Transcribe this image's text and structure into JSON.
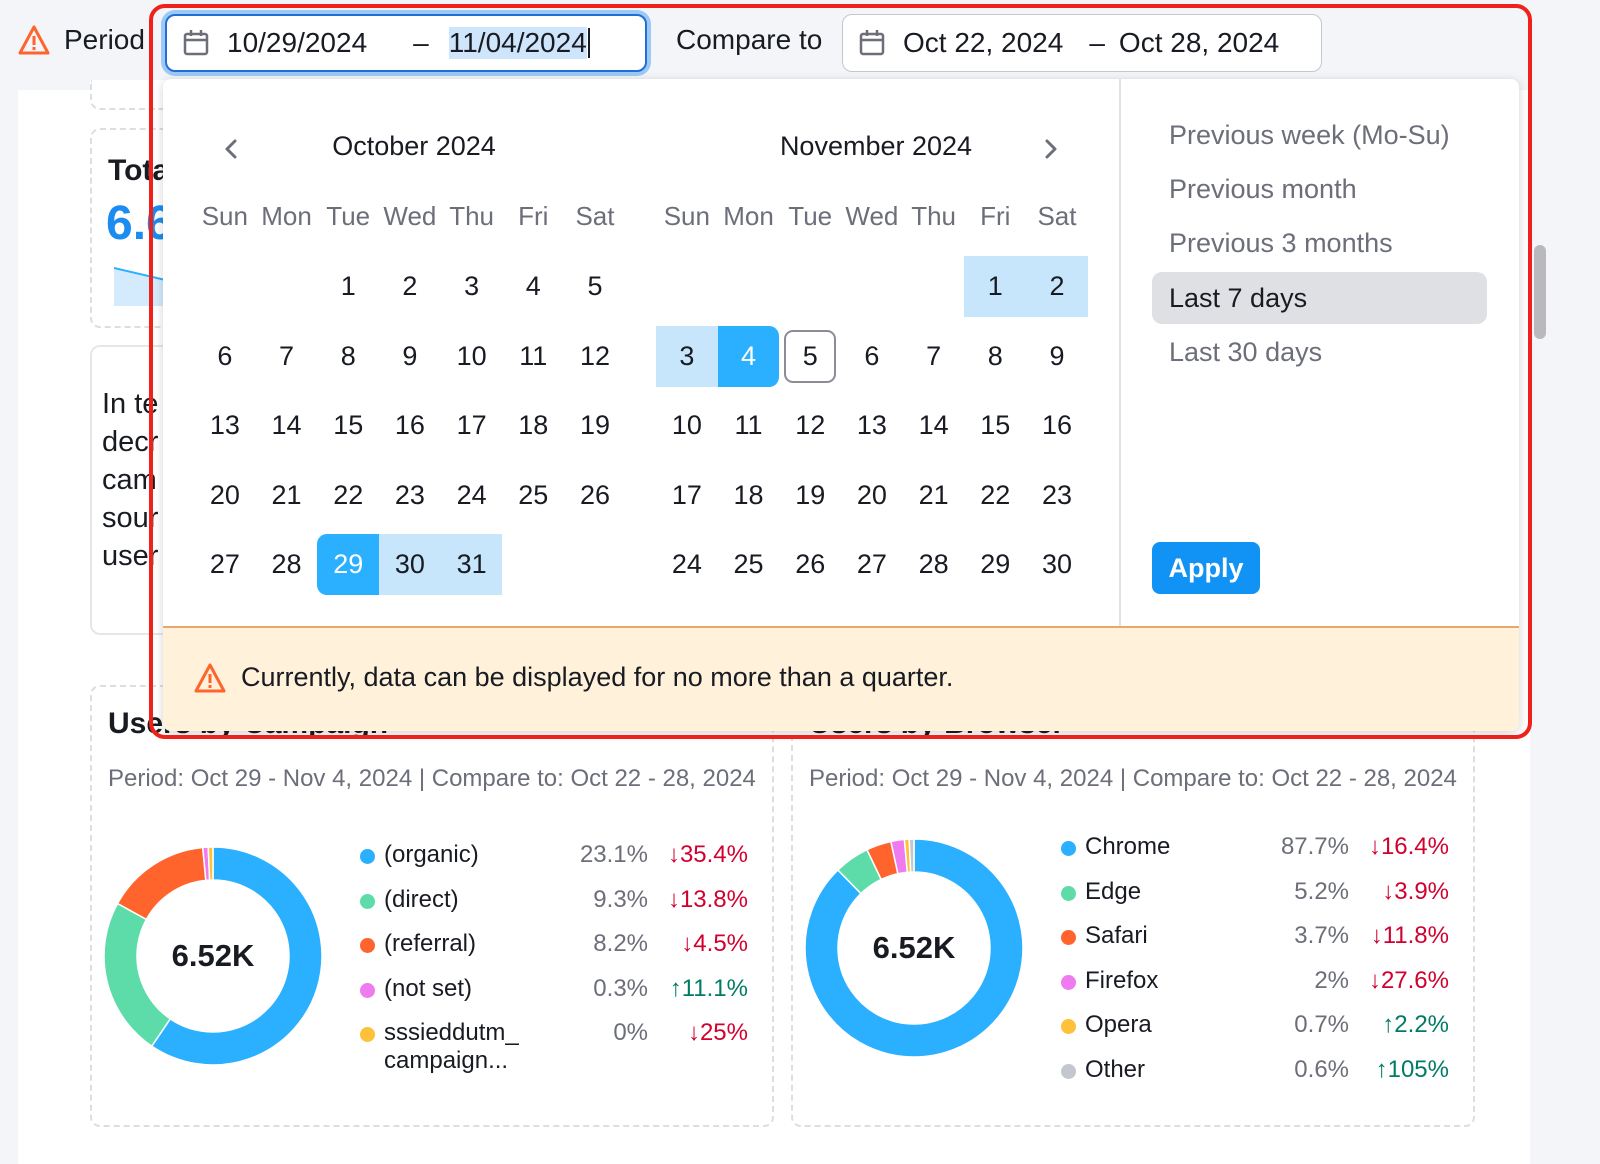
{
  "header": {
    "period_label": "Period",
    "period_start": "10/29/2024",
    "period_separator": "–",
    "period_end": "11/04/2024",
    "compare_label": "Compare to",
    "compare_start": "Oct 22, 2024",
    "compare_separator": "–",
    "compare_end": "Oct 28, 2024"
  },
  "background": {
    "total_card": {
      "title": "Tota",
      "value": "6.6"
    },
    "text_card_lines": [
      "In te",
      "decr",
      "cam",
      "sour",
      "user"
    ]
  },
  "datepicker": {
    "prev_label": "previous month",
    "next_label": "next month",
    "weekdays": [
      "Sun",
      "Mon",
      "Tue",
      "Wed",
      "Thu",
      "Fri",
      "Sat"
    ],
    "months": [
      {
        "title": "October 2024",
        "weeks": [
          [
            "",
            "",
            "1",
            "2",
            "3",
            "4",
            "5"
          ],
          [
            "6",
            "7",
            "8",
            "9",
            "10",
            "11",
            "12"
          ],
          [
            "13",
            "14",
            "15",
            "16",
            "17",
            "18",
            "19"
          ],
          [
            "20",
            "21",
            "22",
            "23",
            "24",
            "25",
            "26"
          ],
          [
            "27",
            "28",
            "29",
            "30",
            "31",
            "",
            ""
          ]
        ],
        "range_start": "29",
        "range_end": null,
        "in_range": [
          "30",
          "31"
        ],
        "today": null
      },
      {
        "title": "November 2024",
        "weeks": [
          [
            "",
            "",
            "",
            "",
            "",
            "1",
            "2"
          ],
          [
            "3",
            "4",
            "5",
            "6",
            "7",
            "8",
            "9"
          ],
          [
            "10",
            "11",
            "12",
            "13",
            "14",
            "15",
            "16"
          ],
          [
            "17",
            "18",
            "19",
            "20",
            "21",
            "22",
            "23"
          ],
          [
            "24",
            "25",
            "26",
            "27",
            "28",
            "29",
            "30"
          ]
        ],
        "range_start": null,
        "range_end": "4",
        "in_range": [
          "1",
          "2",
          "3"
        ],
        "today": "5"
      }
    ],
    "presets": [
      {
        "label": "Previous week (Mo-Su)",
        "active": false
      },
      {
        "label": "Previous month",
        "active": false
      },
      {
        "label": "Previous 3 months",
        "active": false
      },
      {
        "label": "Last 7 days",
        "active": true
      },
      {
        "label": "Last 30 days",
        "active": false
      }
    ],
    "apply_label": "Apply",
    "notice": "Currently, data can be displayed for no more than a quarter."
  },
  "widgets": [
    {
      "title": "Users by Campaign",
      "subtitle": "Period: Oct 29 - Nov 4, 2024 | Compare to: Oct 22 - 28, 2024",
      "total": "6.52K",
      "items": [
        {
          "name": "(organic)",
          "share": "23.1%",
          "change": "35.4%",
          "direction": "down",
          "color": "#2bafff",
          "arc_share": 0.595
        },
        {
          "name": "(direct)",
          "share": "9.3%",
          "change": "13.8%",
          "direction": "down",
          "color": "#5ddca9",
          "arc_share": 0.235
        },
        {
          "name": "(referral)",
          "share": "8.2%",
          "change": "4.5%",
          "direction": "down",
          "color": "#ff642d",
          "arc_share": 0.155
        },
        {
          "name": "(not set)",
          "share": "0.3%",
          "change": "11.1%",
          "direction": "up",
          "color": "#ef7bf0",
          "arc_share": 0.008
        },
        {
          "name": "sssieddutm_ campaign...",
          "share": "0%",
          "change": "25%",
          "direction": "down",
          "color": "#ffc03a",
          "arc_share": 0.007
        }
      ]
    },
    {
      "title": "Users by Browser",
      "subtitle": "Period: Oct 29 - Nov 4, 2024 | Compare to: Oct 22 - 28, 2024",
      "total": "6.52K",
      "items": [
        {
          "name": "Chrome",
          "share": "87.7%",
          "change": "16.4%",
          "direction": "down",
          "color": "#2bafff",
          "arc_share": 0.877
        },
        {
          "name": "Edge",
          "share": "5.2%",
          "change": "3.9%",
          "direction": "down",
          "color": "#5ddca9",
          "arc_share": 0.052
        },
        {
          "name": "Safari",
          "share": "3.7%",
          "change": "11.8%",
          "direction": "down",
          "color": "#ff642d",
          "arc_share": 0.037
        },
        {
          "name": "Firefox",
          "share": "2%",
          "change": "27.6%",
          "direction": "down",
          "color": "#ef7bf0",
          "arc_share": 0.02
        },
        {
          "name": "Opera",
          "share": "0.7%",
          "change": "2.2%",
          "direction": "up",
          "color": "#ffc03a",
          "arc_share": 0.007
        },
        {
          "name": "Other",
          "share": "0.6%",
          "change": "105%",
          "direction": "up",
          "color": "#c4c7cf",
          "arc_share": 0.007
        }
      ]
    }
  ],
  "colors": {
    "accent": "#1093f4",
    "range_fill": "#c7e5fb",
    "range_endpoint": "#2bafff",
    "warning": "#ff642d",
    "notice_bg": "#fff1da",
    "down": "#d1002f",
    "up": "#007c65"
  }
}
